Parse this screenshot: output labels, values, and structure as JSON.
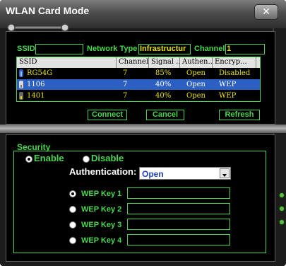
{
  "window": {
    "title": "WLAN Card Mode",
    "close_glyph": "✕"
  },
  "network": {
    "ssid_label": "SSID",
    "ssid_value": "",
    "network_type_label": "Network Type",
    "network_type_value": "Infrastructur",
    "channel_label": "Channel",
    "channel_value": "1"
  },
  "table": {
    "columns": [
      "SSID",
      "Channel",
      "Signal ...",
      "Authen...",
      "Encryp..."
    ],
    "rows": [
      {
        "ssid": "RG54G",
        "channel": "7",
        "signal": "85%",
        "auth": "Open",
        "encryption": "Disabled",
        "selected": false
      },
      {
        "ssid": "1106",
        "channel": "7",
        "signal": "40%",
        "auth": "Open",
        "encryption": "WEP",
        "selected": true
      },
      {
        "ssid": "1401",
        "channel": "7",
        "signal": "40%",
        "auth": "Open",
        "encryption": "WEP",
        "selected": false
      }
    ]
  },
  "buttons": {
    "connect": "Connect",
    "cancel": "Cancel",
    "refresh": "Refresh"
  },
  "security": {
    "label": "Security",
    "enable_label": "Enable",
    "disable_label": "Disable",
    "selected": "enable",
    "auth_label": "Authentication:",
    "auth_value": "Open",
    "wep_keys": [
      {
        "label": "WEP Key 1",
        "value": "",
        "selected": true
      },
      {
        "label": "WEP Key 2",
        "value": "",
        "selected": false
      },
      {
        "label": "WEP Key 3",
        "value": "",
        "selected": false
      },
      {
        "label": "WEP Key 4",
        "value": "",
        "selected": false
      }
    ]
  },
  "colors": {
    "accent": "#46d84c",
    "value_yellow": "#e8e000",
    "selection": "#2c5fc2",
    "background": "#000000"
  }
}
